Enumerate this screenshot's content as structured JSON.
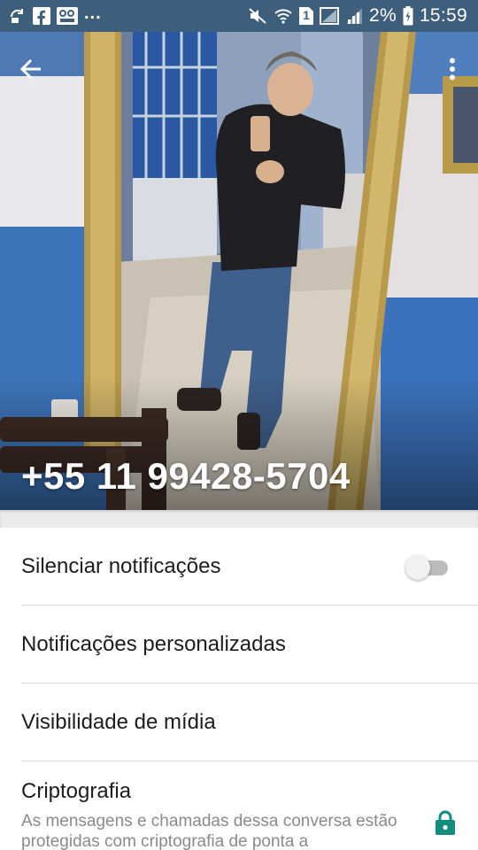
{
  "status_bar": {
    "left_icons": [
      "sync-icon",
      "facebook-icon",
      "cartoon-icon"
    ],
    "overflow": "...",
    "right_icons": [
      "mute-icon",
      "wifi-icon",
      "sim1-icon",
      "no-signal-icon",
      "signal-icon",
      "battery-icon"
    ],
    "sim_label": "1",
    "battery_percent": "2%",
    "time": "15:59"
  },
  "header": {
    "contact_name": "+55 11 99428-5704",
    "back_icon": "arrow-left-icon",
    "menu_icon": "more-vertical-icon"
  },
  "settings": {
    "mute": {
      "label": "Silenciar notificações",
      "enabled": false
    },
    "custom_notifications": {
      "label": "Notificações personalizadas"
    },
    "media_visibility": {
      "label": "Visibilidade de mídia"
    },
    "encryption": {
      "label": "Criptografia",
      "description": "As mensagens e chamadas dessa conversa estão protegidas com criptografia de ponta a",
      "icon": "lock-icon"
    }
  },
  "colors": {
    "status_bar": "#3e5f7c",
    "accent": "#128c7e",
    "toggle_off_track": "#bcbcbc"
  }
}
